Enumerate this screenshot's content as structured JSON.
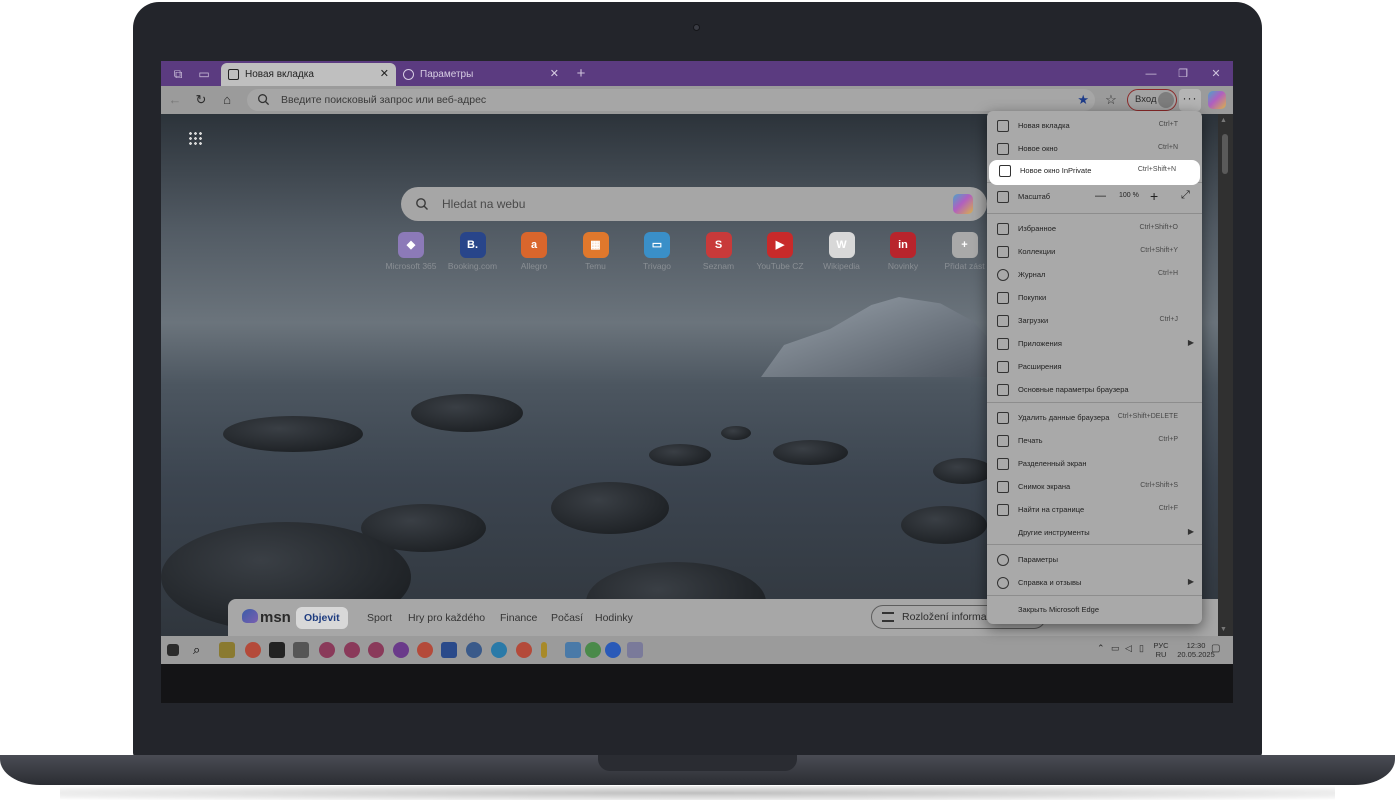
{
  "browser": {
    "tabs": [
      {
        "label": "Новая вкладка",
        "active": true
      },
      {
        "label": "Параметры",
        "active": false
      }
    ],
    "address_placeholder": "Введите поисковый запрос или веб-адрес",
    "login_label": "Вход"
  },
  "newtab": {
    "search_placeholder": "Hledat na webu",
    "quick_links": [
      {
        "label": "Microsoft 365",
        "icon": "microsoft-365-icon",
        "glyph": "◆",
        "color": "#8c7ab8"
      },
      {
        "label": "Booking.com",
        "icon": "booking-icon",
        "glyph": "B.",
        "color": "#28458a"
      },
      {
        "label": "Allegro",
        "icon": "allegro-icon",
        "glyph": "a",
        "color": "#d9662c"
      },
      {
        "label": "Temu",
        "icon": "temu-icon",
        "glyph": "▦",
        "color": "#e0782c"
      },
      {
        "label": "Trivago",
        "icon": "trivago-icon",
        "glyph": "▭",
        "color": "#3a8fc8"
      },
      {
        "label": "Seznam",
        "icon": "seznam-icon",
        "glyph": "S",
        "color": "#c83a3a"
      },
      {
        "label": "YouTube CZ",
        "icon": "youtube-icon",
        "glyph": "▶",
        "color": "#c82a2a"
      },
      {
        "label": "Wikipedia",
        "icon": "wikipedia-icon",
        "glyph": "W",
        "color": "#d8d8d8"
      },
      {
        "label": "Novinky",
        "icon": "novinky-icon",
        "glyph": "in",
        "color": "#b8242c"
      },
      {
        "label": "Přidat zást",
        "icon": "add-shortcut-icon",
        "glyph": "+",
        "color": "#a9a9a9"
      }
    ],
    "msn": {
      "logo": "msn",
      "tabs": [
        "Objevit",
        "Sport",
        "Hry pro každého",
        "Finance",
        "Počasí",
        "Hodinky"
      ],
      "layout_button": "Rozložení informací"
    }
  },
  "menu": {
    "items": [
      {
        "label": "Новая вкладка",
        "shortcut": "Ctrl+T",
        "icon": "new-tab-icon"
      },
      {
        "label": "Новое окно",
        "shortcut": "Ctrl+N",
        "icon": "new-window-icon"
      },
      {
        "label": "Новое окно InPrivate",
        "shortcut": "Ctrl+Shift+N",
        "icon": "inprivate-window-icon",
        "highlight": true
      },
      {
        "label": "Масштаб",
        "zoom": "100 %",
        "icon": "zoom-icon"
      },
      {
        "label": "Избранное",
        "shortcut": "Ctrl+Shift+O",
        "icon": "favorites-icon"
      },
      {
        "label": "Коллекции",
        "shortcut": "Ctrl+Shift+Y",
        "icon": "collections-icon"
      },
      {
        "label": "Журнал",
        "shortcut": "Ctrl+H",
        "icon": "history-icon"
      },
      {
        "label": "Покупки",
        "shortcut": "",
        "icon": "shopping-icon"
      },
      {
        "label": "Загрузки",
        "shortcut": "Ctrl+J",
        "icon": "downloads-icon"
      },
      {
        "label": "Приложения",
        "shortcut": "",
        "submenu": true,
        "icon": "apps-icon"
      },
      {
        "label": "Расширения",
        "shortcut": "",
        "icon": "extensions-icon"
      },
      {
        "label": "Основные параметры браузера",
        "shortcut": "",
        "icon": "browser-essentials-icon"
      },
      {
        "label": "Удалить данные браузера",
        "shortcut": "Ctrl+Shift+DELETE",
        "icon": "delete-data-icon"
      },
      {
        "label": "Печать",
        "shortcut": "Ctrl+P",
        "icon": "print-icon"
      },
      {
        "label": "Разделенный экран",
        "shortcut": "",
        "icon": "split-screen-icon"
      },
      {
        "label": "Снимок экрана",
        "shortcut": "Ctrl+Shift+S",
        "icon": "screenshot-icon"
      },
      {
        "label": "Найти на странице",
        "shortcut": "Ctrl+F",
        "icon": "find-icon"
      },
      {
        "label": "Другие инструменты",
        "shortcut": "",
        "submenu": true,
        "icon": ""
      },
      {
        "label": "Параметры",
        "shortcut": "",
        "icon": "settings-icon"
      },
      {
        "label": "Справка и отзывы",
        "shortcut": "",
        "submenu": true,
        "icon": "help-icon"
      },
      {
        "label": "Закрыть Microsoft Edge",
        "shortcut": "",
        "icon": ""
      }
    ]
  },
  "taskbar": {
    "lang": "РУС",
    "lang_sub": "RU",
    "time": "12:30",
    "date": "20.05.2025"
  },
  "colors": {
    "titlebar": "#5b3b80",
    "highlight": "#ffffff"
  }
}
